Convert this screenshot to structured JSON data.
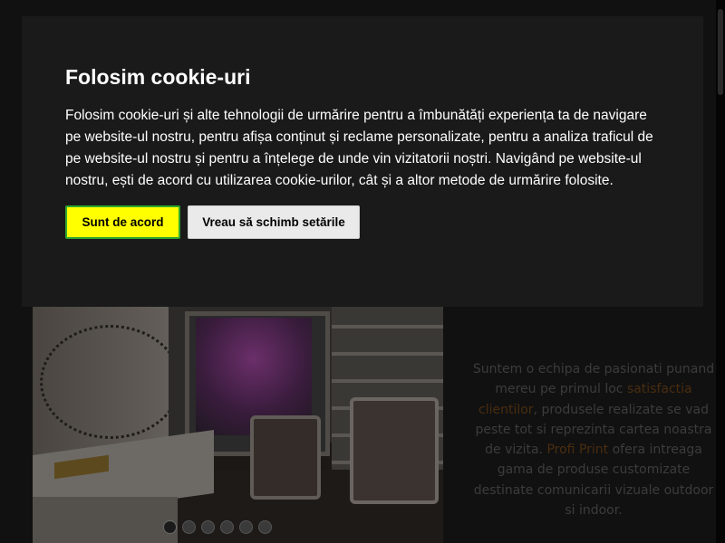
{
  "cookie_banner": {
    "title": "Folosim cookie-uri",
    "text": "Folosim cookie-uri și alte tehnologii de urmărire pentru a îmbunătăți experiența ta de navigare pe website-ul nostru, pentru afișa conținut și reclame personalizate, pentru a analiza traficul de pe website-ul nostru și pentru a înțelege de unde vin vizitatorii noștri. Navigând pe website-ul nostru, ești de acord cu utilizarea cookie-urilor, cât și a altor metode de urmărire folosite.",
    "accept_label": "Sunt de acord",
    "settings_label": "Vreau să schimb setările",
    "accept_color": "#ffff00",
    "accept_border_color": "#2ea82e"
  },
  "side_text": {
    "part1": "Suntem o echipa de pasionati punand mereu pe primul loc ",
    "highlight1": "satisfactia clientilor",
    "part2": ", produsele realizate se vad peste tot si reprezinta cartea noastra de vizita. ",
    "highlight2": "Profi Print",
    "part3": " ofera intreaga gama de produse customizate destinate comunicarii vizuale outdoor si indoor."
  },
  "slider": {
    "slide_count": 6,
    "active_index": 0
  }
}
